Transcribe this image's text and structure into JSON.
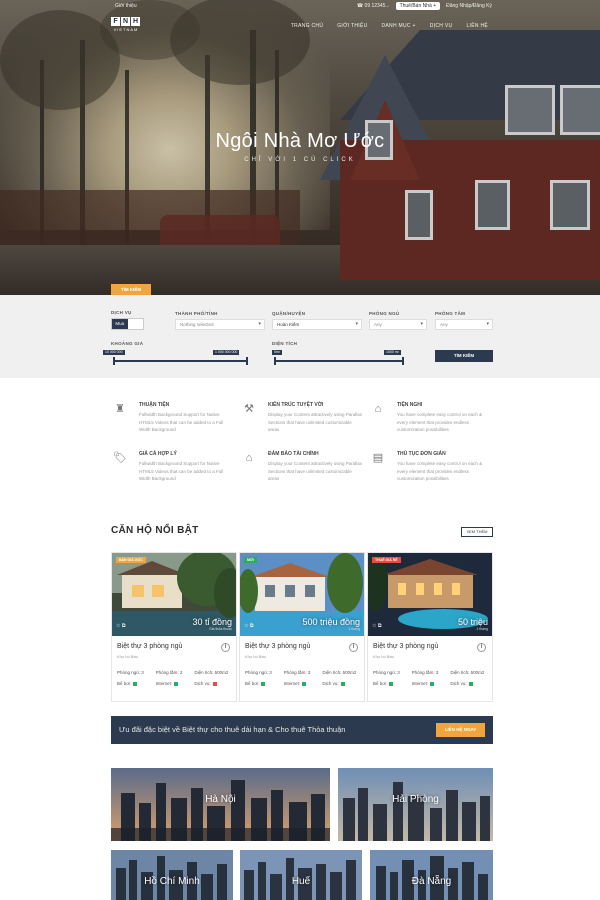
{
  "topbar": {
    "left": "Giới thiệu",
    "phone": "☎ 09 12345...",
    "cta": "Thuê/Bán Nhà +",
    "login": "Đăng Nhập/Đăng Ký"
  },
  "logo": {
    "letters": [
      "F",
      "N",
      "H"
    ],
    "sub": "VIETNAM"
  },
  "nav": [
    "TRANG CHỦ",
    "GIỚI THIỆU",
    "DANH MỤC +",
    "DỊCH VỤ",
    "LIÊN HỆ"
  ],
  "hero": {
    "title": "Ngôi Nhà Mơ Ước",
    "subtitle": "CHỈ VỚI 1 CÚ CLICK",
    "tab": "TÌM KIẾM"
  },
  "search": {
    "labels": {
      "service": "DỊCH VỤ",
      "city": "THÀNH PHỐ/TỈNH",
      "district": "QUẬN/HUYỆN",
      "bedrooms": "PHÒNG NGỦ",
      "bathrooms": "PHÒNG TẮM",
      "price": "KHOẢNG GIÁ",
      "area": "DIỆN TÍCH"
    },
    "toggle": [
      "Mua",
      "Thuê"
    ],
    "city_value": "Nothing selected",
    "district_value": "Hoàn Kiếm",
    "bedrooms_value": "Any",
    "bathrooms_value": "Any",
    "price_min": "10 000 000",
    "price_max": "1 000 000 000",
    "area_min": "0m²",
    "area_max": "1000 m²",
    "button": "TÌM KIẾM"
  },
  "features": [
    {
      "icon": "♜",
      "title": "THUẬN TIỆN",
      "desc": "Fullwidth Background Support for Native HTML5 Videos that can be added to a Full Width Background"
    },
    {
      "icon": "⚒",
      "title": "KIẾN TRÚC TUYỆT VỜI",
      "desc": "Display your Content attractively using Parallax Sections that have unlimited customizable areas"
    },
    {
      "icon": "⌂",
      "title": "TIỆN NGHI",
      "desc": "You have complete easy control on each & every element that provides endless customization possibilities"
    },
    {
      "icon": "🏷",
      "title": "GIÁ CẢ HỢP LÝ",
      "desc": "Fullwidth Background Support for Native HTML5 Videos that can be added to a Full Width Background"
    },
    {
      "icon": "⌂",
      "title": "ĐẢM BẢO TÀI CHÍNH",
      "desc": "Display your Content attractively using Parallax Sections that have unlimited customizable areas"
    },
    {
      "icon": "▤",
      "title": "THỦ TỤC ĐƠN GIẢN",
      "desc": "You have complete easy control on each & every element that provides endless customization possibilities"
    }
  ],
  "featured": {
    "title": "CĂN HỘ NỔI BẬT",
    "see_all": "XEM THÊM",
    "cards": [
      {
        "badge": "BÁN GIÁ GỐC",
        "badge_color": "#f1a63d",
        "price": "30 tỉ đồng",
        "price_note": "Giá thỏa thuận",
        "icons": "☆  ⧉",
        "name": "Biệt thự 3 phòng ngủ",
        "location": "Khu hồ Bảo",
        "specs": [
          [
            {
              "t": "Phòng ngủ: 3"
            },
            {
              "t": "Phòng tắm: 2"
            },
            {
              "t": "Diện tích: 500m2"
            }
          ],
          [
            {
              "t": "Bể bơi:",
              "c": "yes"
            },
            {
              "t": "Internet:",
              "c": "yes"
            },
            {
              "t": "Dịch vụ:",
              "c": "no"
            }
          ]
        ]
      },
      {
        "badge": "MỚI",
        "badge_color": "#27ae60",
        "price": "500 triệu đồng",
        "price_note": "1 tháng",
        "icons": "☆  ⧉",
        "name": "Biệt thự 3 phòng ngủ",
        "location": "Khu hồ Bảo",
        "specs": [
          [
            {
              "t": "Phòng ngủ: 3"
            },
            {
              "t": "Phòng tắm: 3"
            },
            {
              "t": "Diện tích: 500m2"
            }
          ],
          [
            {
              "t": "Bể bơi:",
              "c": "yes"
            },
            {
              "t": "Internet:",
              "c": "yes"
            },
            {
              "t": "Dịch vụ:",
              "c": "yes"
            }
          ]
        ]
      },
      {
        "badge": "THUÊ GIÁ RẺ",
        "badge_color": "#e74c3c",
        "price": "50 triệu",
        "price_note": "1 tháng",
        "icons": "☆  ⧉",
        "name": "Biệt thự 3 phòng ngủ",
        "location": "Khu hồ Bảo",
        "specs": [
          [
            {
              "t": "Phòng ngủ: 3"
            },
            {
              "t": "Phòng tắm: 3"
            },
            {
              "t": "Diện tích: 500m2"
            }
          ],
          [
            {
              "t": "Bể bơi:",
              "c": "yes"
            },
            {
              "t": "Internet:",
              "c": "yes"
            },
            {
              "t": "Dịch vụ:",
              "c": "yes"
            }
          ]
        ]
      }
    ]
  },
  "promo": {
    "text": "Ưu đãi đặc biệt về Biệt thự cho thuê dài hạn & Cho thuê Thỏa thuận",
    "button": "LIÊN HỆ NGAY"
  },
  "cities": [
    "Hà Nội",
    "Hải Phòng",
    "Hồ Chí Minh",
    "Huế",
    "Đà Nẵng"
  ]
}
